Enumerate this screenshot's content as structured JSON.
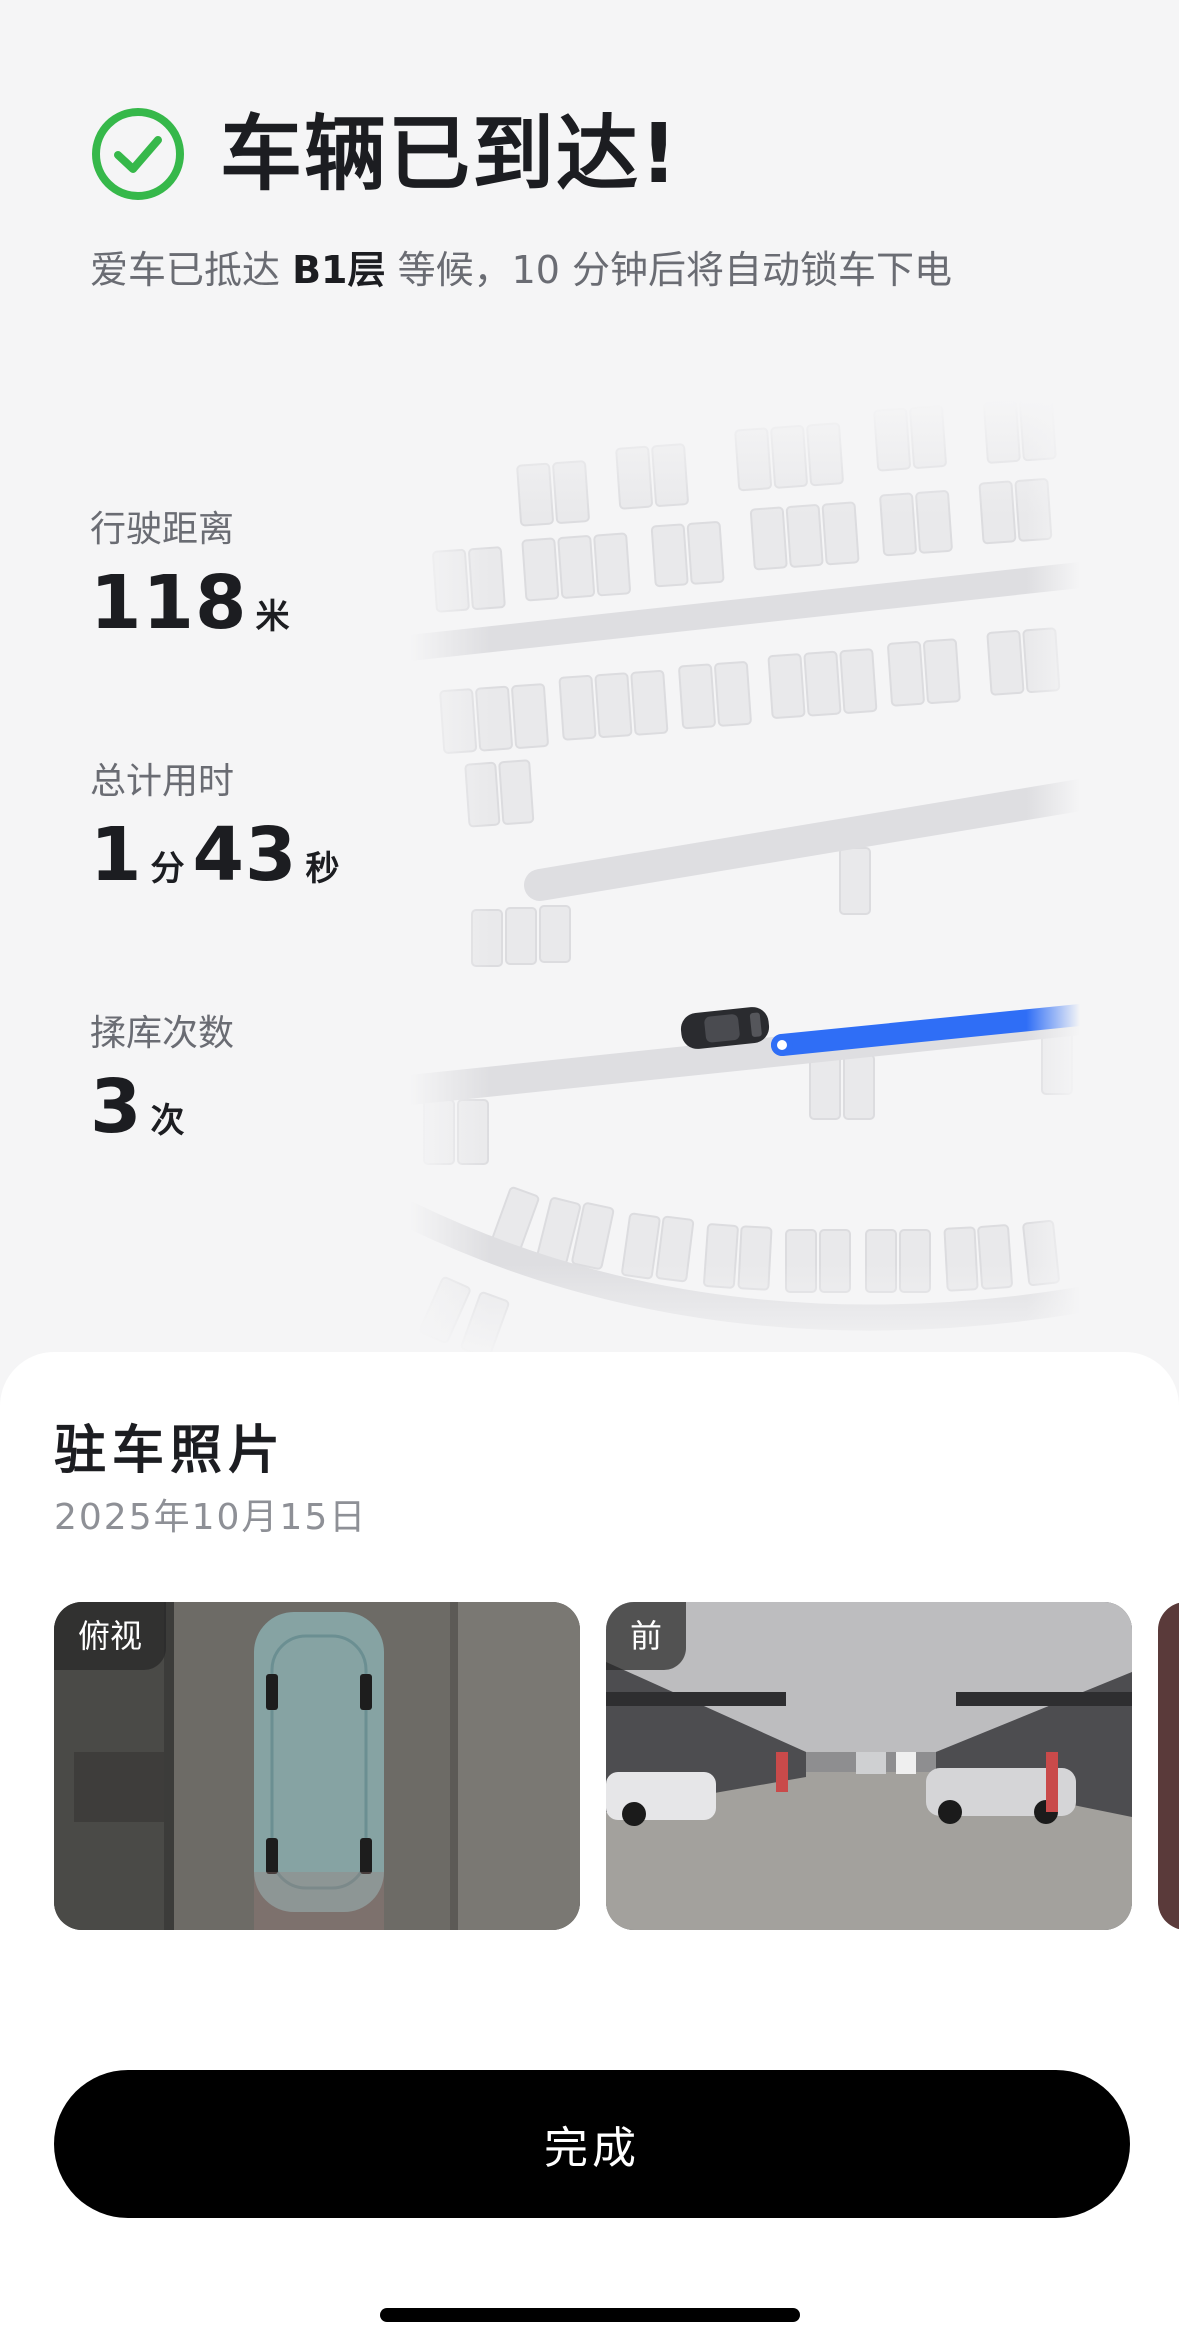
{
  "header": {
    "title": "车辆已到达!",
    "subtitle_prefix": "爱车已抵达 ",
    "floor": "B1层",
    "subtitle_suffix": " 等候，10 分钟后将自动锁车下电",
    "check_icon": "check-circle-icon",
    "accent_color": "#36b84a"
  },
  "stats": {
    "distance": {
      "label": "行驶距离",
      "value": "118",
      "unit": "米"
    },
    "duration": {
      "label": "总计用时",
      "minutes": "1",
      "minutes_unit": "分",
      "seconds": "43",
      "seconds_unit": "秒"
    },
    "maneuvers": {
      "label": "揉库次数",
      "value": "3",
      "unit": "次"
    }
  },
  "map": {
    "route_color": "#2f6ef6",
    "car_icon": "car-icon"
  },
  "parking_photos": {
    "title": "驻车照片",
    "date": "2025年10月15日",
    "photos": [
      {
        "tag": "俯视"
      },
      {
        "tag": "前"
      }
    ]
  },
  "actions": {
    "done_label": "完成"
  }
}
